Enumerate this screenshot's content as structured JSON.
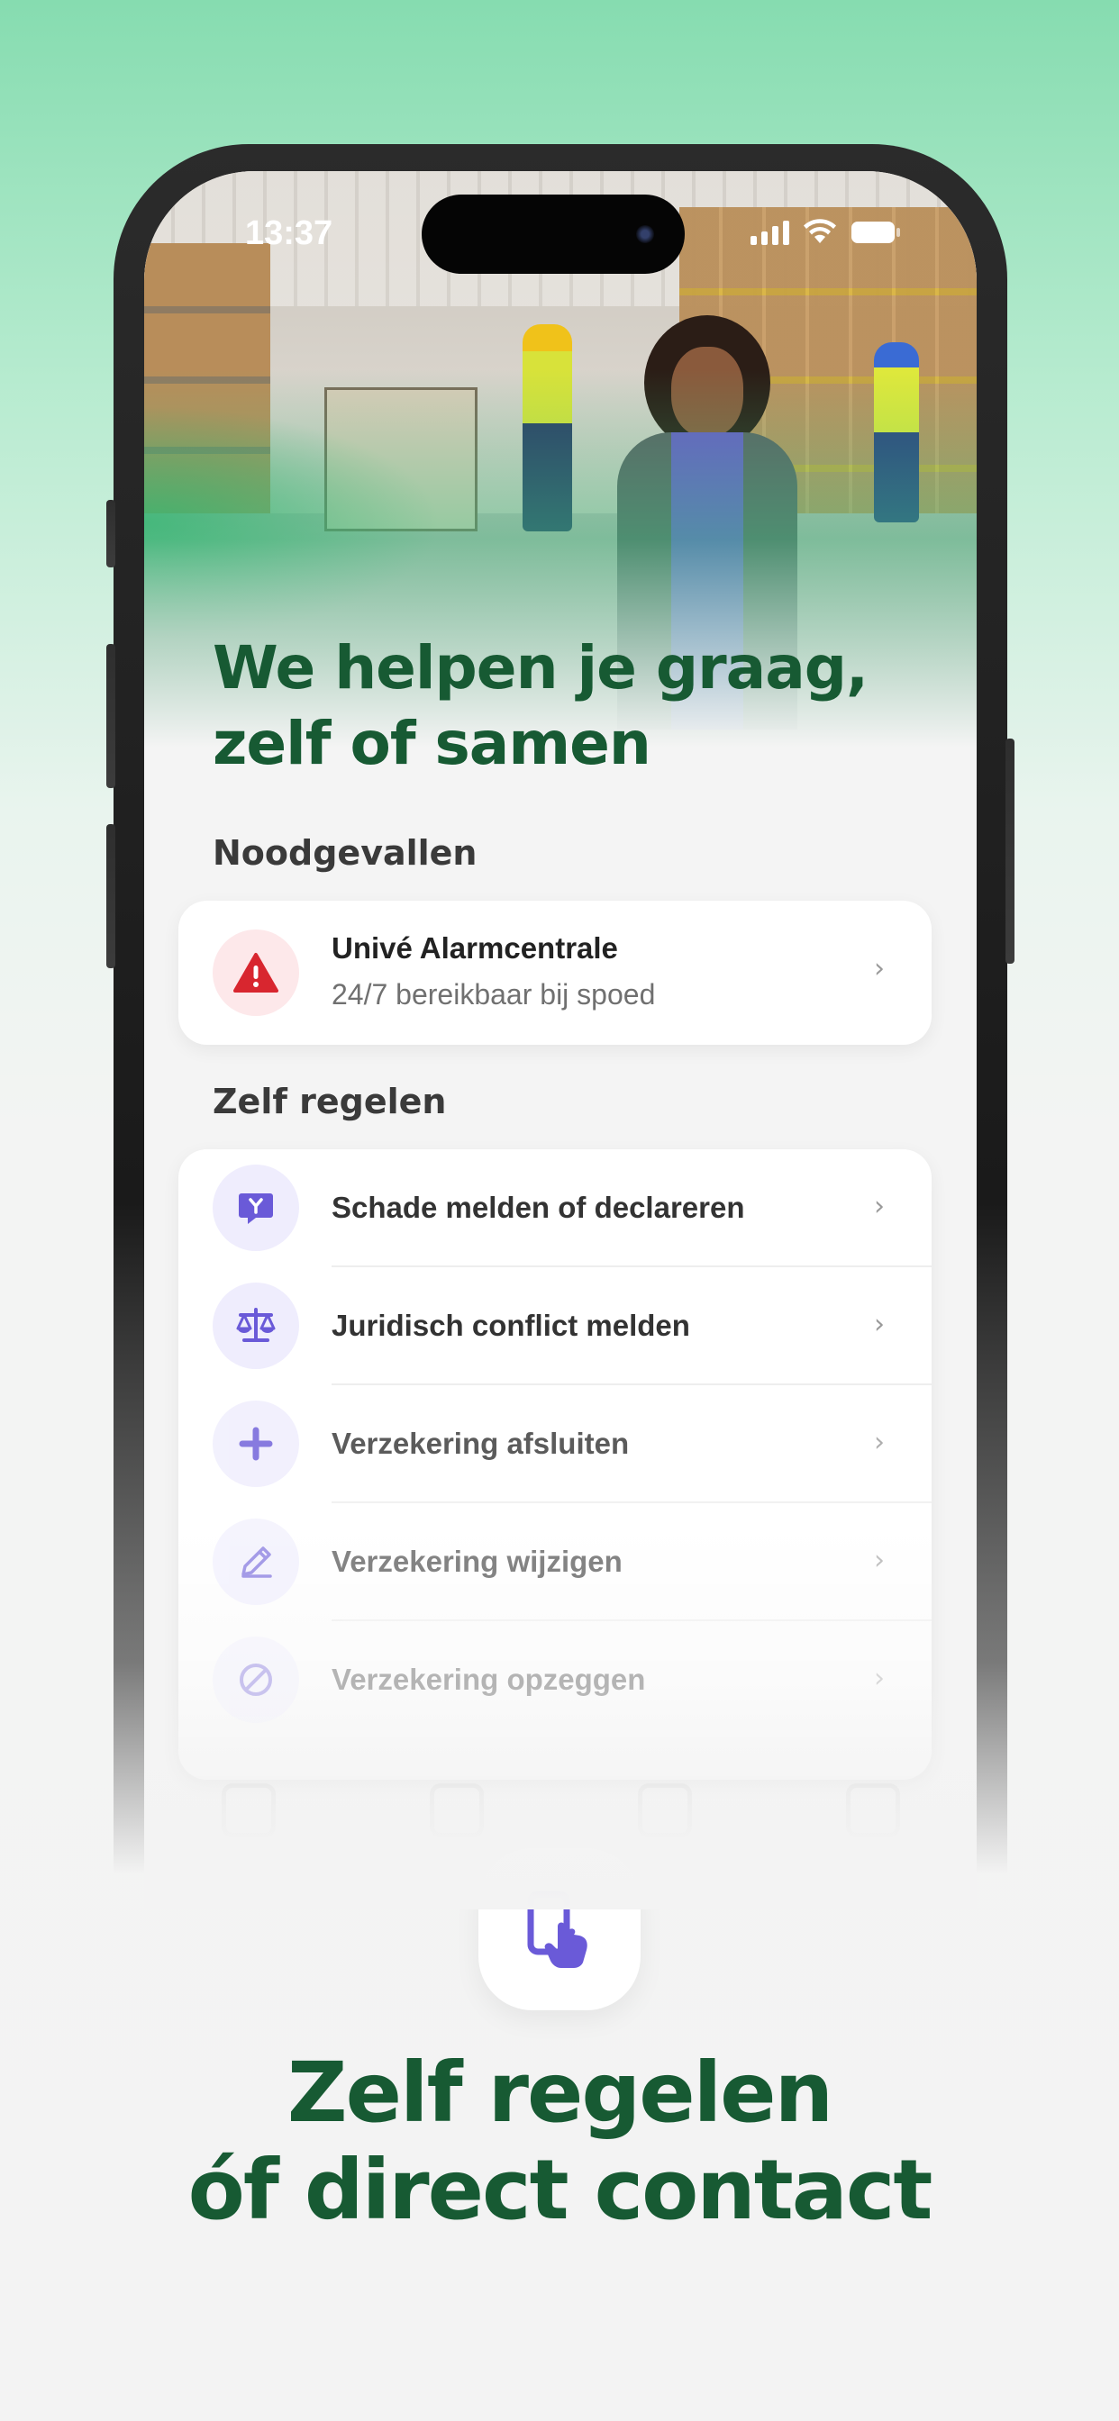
{
  "status_bar": {
    "time": "13:37"
  },
  "headline": "We helpen je graag,\nzelf of samen",
  "sections": {
    "emergency": {
      "title": "Noodgevallen",
      "item": {
        "icon": "warning-icon",
        "title": "Univé Alarmcentrale",
        "subtitle": "24/7 bereikbaar bij spoed",
        "chevron": "›"
      }
    },
    "self_service": {
      "title": "Zelf regelen",
      "items": [
        {
          "icon": "claim-icon",
          "label": "Schade melden of declareren",
          "chevron": "›"
        },
        {
          "icon": "scale-icon",
          "label": "Juridisch conflict melden",
          "chevron": "›"
        },
        {
          "icon": "plus-icon",
          "label": "Verzekering afsluiten",
          "chevron": "›"
        },
        {
          "icon": "pencil-icon",
          "label": "Verzekering wijzigen",
          "chevron": "›"
        },
        {
          "icon": "cancel-icon",
          "label": "Verzekering opzeggen",
          "chevron": "›"
        }
      ]
    }
  },
  "promo": {
    "icon": "phone-tap-icon",
    "text": "Zelf regelen\nóf direct contact"
  },
  "colors": {
    "brand_green": "#175a33",
    "accent_purple": "#6a5ad8",
    "alert_red": "#d8262f",
    "background_top": "#86dcb0"
  }
}
